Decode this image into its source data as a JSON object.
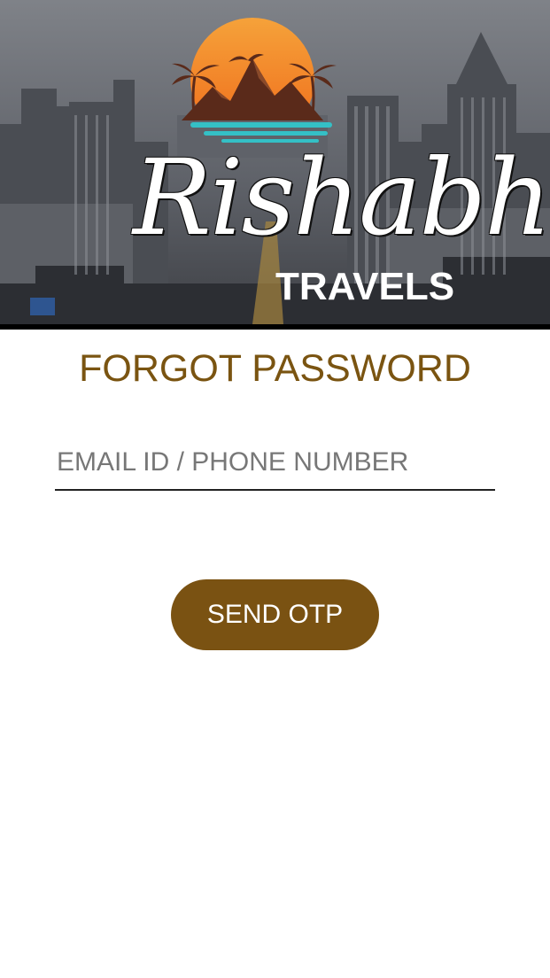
{
  "header": {
    "brand_name": "Rishabh",
    "brand_subtitle": "TRAVELS",
    "background_image": "city-skyline",
    "logo_icon": "mountain-sunset-palm-icon"
  },
  "page": {
    "title": "FORGOT PASSWORD"
  },
  "form": {
    "identifier_placeholder": "EMAIL ID / PHONE NUMBER",
    "identifier_value": "",
    "submit_label": "SEND OTP"
  },
  "colors": {
    "accent": "#7a5411",
    "button": "#7a5212",
    "button_text": "#ffffff",
    "underline": "#222222"
  }
}
